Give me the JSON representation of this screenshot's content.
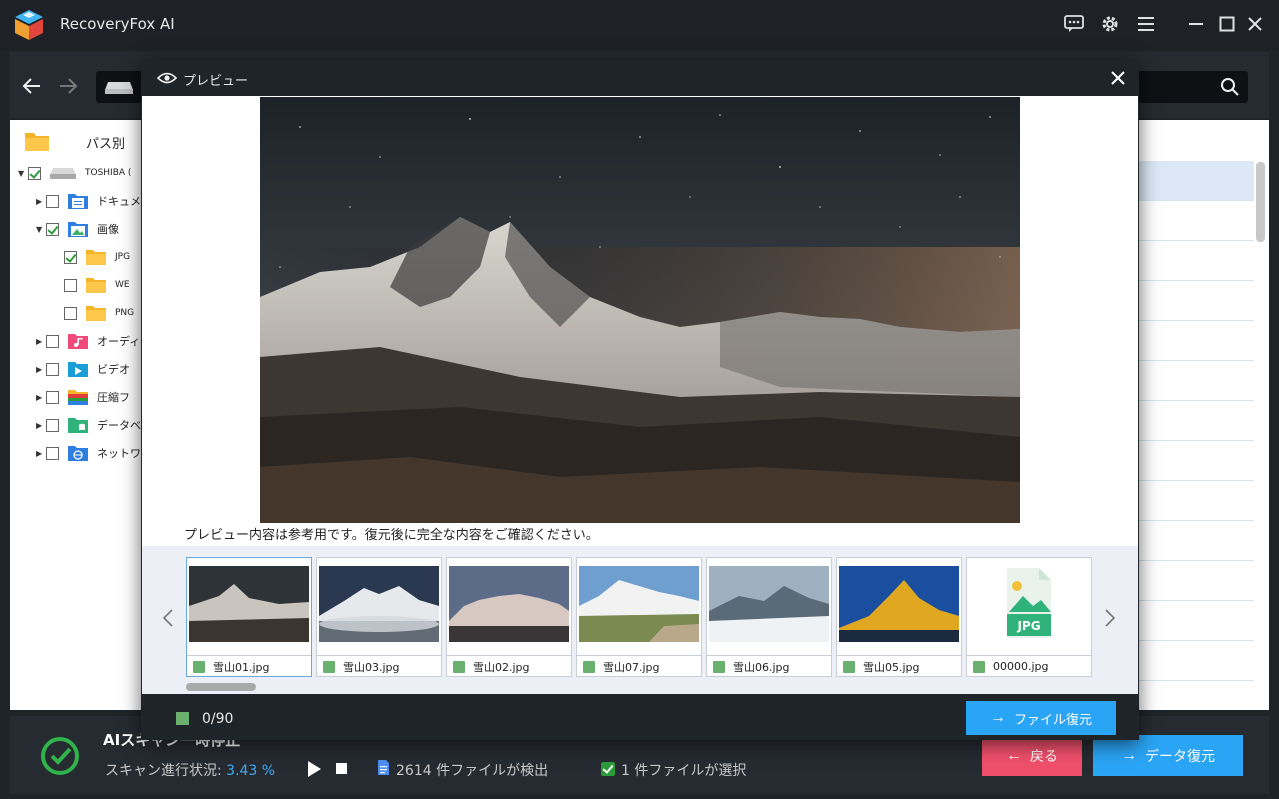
{
  "app": {
    "title": "RecoveryFox AI"
  },
  "titlebar": {
    "icons": [
      "feedback-icon",
      "settings-icon",
      "menu-icon",
      "minimize-icon",
      "maximize-icon",
      "close-icon"
    ]
  },
  "tree": {
    "header": "パス別",
    "items": [
      {
        "label": "TOSHIBA (",
        "checked": true,
        "icon": "drive-icon"
      },
      {
        "label": "ドキュメ",
        "checked": false,
        "icon": "document-folder-icon"
      },
      {
        "label": "画像",
        "checked": true,
        "icon": "image-folder-icon"
      },
      {
        "label": "JPG",
        "checked": true,
        "icon": "folder-icon"
      },
      {
        "label": "WE",
        "checked": false,
        "icon": "folder-icon"
      },
      {
        "label": "PNG",
        "checked": false,
        "icon": "folder-icon"
      },
      {
        "label": "オーディ",
        "checked": false,
        "icon": "audio-folder-icon"
      },
      {
        "label": "ビデオ",
        "checked": false,
        "icon": "video-folder-icon"
      },
      {
        "label": "圧縮フ",
        "checked": false,
        "icon": "archive-folder-icon"
      },
      {
        "label": "データベ",
        "checked": false,
        "icon": "database-folder-icon"
      },
      {
        "label": "ネットワ",
        "checked": false,
        "icon": "network-folder-icon"
      }
    ]
  },
  "preview": {
    "title": "プレビュー",
    "notice": "プレビュー内容は参考用です。復元後に完全な内容をご確認ください。",
    "thumbnails": [
      {
        "name": "雪山01.jpg"
      },
      {
        "name": "雪山03.jpg"
      },
      {
        "name": "雪山02.jpg"
      },
      {
        "name": "雪山07.jpg"
      },
      {
        "name": "雪山06.jpg"
      },
      {
        "name": "雪山05.jpg"
      },
      {
        "name": "00000.jpg",
        "placeholder_label": "JPG"
      }
    ],
    "selected_count": "0/90",
    "recover_label": "ファイル復元"
  },
  "status": {
    "title": "AIスキャン一時停止",
    "progress_label": "スキャン進行状況: ",
    "progress_value": "3.43 %",
    "found_text": "2614 件ファイルが検出",
    "selected_text": "1 件ファイルが選択",
    "back_label": "戻る",
    "recover_label": "データ復元"
  },
  "colors": {
    "accent": "#2aa4f4",
    "back": "#ef4f6a",
    "check": "#2a9d3a",
    "progress": "#3fa9f5"
  }
}
